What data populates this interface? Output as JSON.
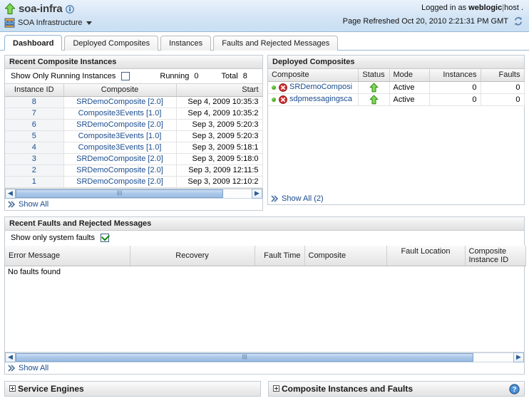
{
  "header": {
    "title": "soa-infra",
    "title_arrow_icon": "arrow-up-green-icon",
    "info_icon": "info-icon",
    "subtitle": "SOA Infrastructure",
    "subtitle_icon": "soa-infrastructure-icon",
    "menu_caret_icon": "chevron-down-icon",
    "logged_in_prefix": "Logged in as",
    "logged_in_user": "weblogic",
    "logged_in_host": "host .",
    "page_refreshed": "Page Refreshed Oct 20, 2010 2:21:31 PM GMT",
    "refresh_icon": "refresh-icon"
  },
  "tabs": [
    {
      "label": "Dashboard",
      "active": true
    },
    {
      "label": "Deployed Composites",
      "active": false
    },
    {
      "label": "Instances",
      "active": false
    },
    {
      "label": "Faults and Rejected Messages",
      "active": false
    }
  ],
  "recent_instances": {
    "panel_title": "Recent Composite Instances",
    "filter_label": "Show Only Running Instances",
    "filter_checked": false,
    "running_label": "Running",
    "running_value": "0",
    "total_label": "Total",
    "total_value": "8",
    "columns": [
      "Instance ID",
      "Composite",
      "Start"
    ],
    "rows": [
      {
        "id": "8",
        "composite": "SRDemoComposite [2.0]",
        "start": "Sep 4, 2009 10:35:3"
      },
      {
        "id": "7",
        "composite": "Composite3Events [1.0]",
        "start": "Sep 4, 2009 10:35:2"
      },
      {
        "id": "6",
        "composite": "SRDemoComposite [2.0]",
        "start": "Sep 3, 2009 5:20:3"
      },
      {
        "id": "5",
        "composite": "Composite3Events [1.0]",
        "start": "Sep 3, 2009 5:20:3"
      },
      {
        "id": "4",
        "composite": "Composite3Events [1.0]",
        "start": "Sep 3, 2009 5:18:1"
      },
      {
        "id": "3",
        "composite": "SRDemoComposite [2.0]",
        "start": "Sep 3, 2009 5:18:0"
      },
      {
        "id": "2",
        "composite": "SRDemoComposite [2.0]",
        "start": "Sep 3, 2009 12:11:5"
      },
      {
        "id": "1",
        "composite": "SRDemoComposite [2.0]",
        "start": "Sep 3, 2009 12:10:2"
      }
    ],
    "show_all_label": "Show All",
    "show_all_icon": "double-chevron-right-icon"
  },
  "deployed_composites": {
    "panel_title": "Deployed Composites",
    "columns": [
      "Composite",
      "Status",
      "Mode",
      "Instances",
      "Faults"
    ],
    "rows": [
      {
        "state_icon": "dot-green-icon",
        "error_icon": "error-red-icon",
        "name": "SRDemoComposi",
        "status_icon": "arrow-up-green-icon",
        "mode": "Active",
        "instances": "0",
        "faults": "0"
      },
      {
        "state_icon": "dot-green-icon",
        "error_icon": "error-red-icon",
        "name": "sdpmessagingsca",
        "status_icon": "arrow-up-green-icon",
        "mode": "Active",
        "instances": "0",
        "faults": "0"
      }
    ],
    "show_all_label": "Show All (2)",
    "show_all_icon": "double-chevron-right-icon"
  },
  "recent_faults": {
    "panel_title": "Recent Faults and Rejected Messages",
    "filter_label": "Show only system faults",
    "filter_checked": true,
    "columns": [
      "Error Message",
      "Recovery",
      "Fault Time",
      "Composite",
      "Fault Location",
      "Composite Instance ID"
    ],
    "empty_text": "No faults found",
    "show_all_label": "Show All",
    "show_all_icon": "double-chevron-right-icon"
  },
  "bottom_panels": [
    {
      "label": "Service Engines",
      "expand_icon": "expand-plus-icon",
      "help_icon": null
    },
    {
      "label": "Composite Instances and Faults",
      "expand_icon": "expand-plus-icon",
      "help_icon": "help-icon"
    }
  ],
  "colors": {
    "header_bg": "#d3e4f5",
    "link": "#1a4c8f",
    "status_green": "#3f9d1a",
    "error_red": "#cc2222",
    "scroll_thumb": "#a9c6e8"
  }
}
